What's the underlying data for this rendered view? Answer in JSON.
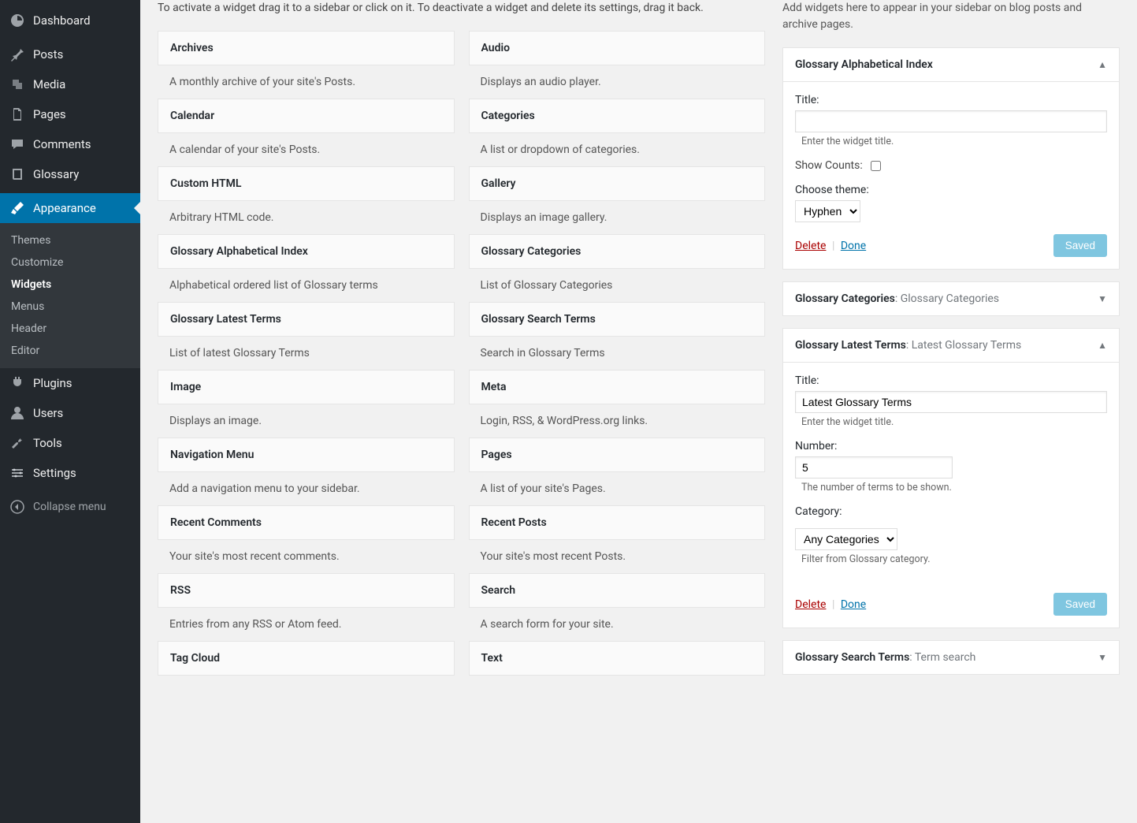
{
  "sidebar": {
    "items": [
      {
        "label": "Dashboard"
      },
      {
        "label": "Posts"
      },
      {
        "label": "Media"
      },
      {
        "label": "Pages"
      },
      {
        "label": "Comments"
      },
      {
        "label": "Glossary"
      },
      {
        "label": "Appearance"
      },
      {
        "label": "Plugins"
      },
      {
        "label": "Users"
      },
      {
        "label": "Tools"
      },
      {
        "label": "Settings"
      }
    ],
    "sub": [
      {
        "label": "Themes"
      },
      {
        "label": "Customize"
      },
      {
        "label": "Widgets"
      },
      {
        "label": "Menus"
      },
      {
        "label": "Header"
      },
      {
        "label": "Editor"
      }
    ],
    "collapse": "Collapse menu"
  },
  "intro": "To activate a widget drag it to a sidebar or click on it. To deactivate a widget and delete its settings, drag it back.",
  "widgets": [
    {
      "name": "Archives",
      "desc": "A monthly archive of your site's Posts."
    },
    {
      "name": "Audio",
      "desc": "Displays an audio player."
    },
    {
      "name": "Calendar",
      "desc": "A calendar of your site's Posts."
    },
    {
      "name": "Categories",
      "desc": "A list or dropdown of categories."
    },
    {
      "name": "Custom HTML",
      "desc": "Arbitrary HTML code."
    },
    {
      "name": "Gallery",
      "desc": "Displays an image gallery."
    },
    {
      "name": "Glossary Alphabetical Index",
      "desc": "Alphabetical ordered list of Glossary terms"
    },
    {
      "name": "Glossary Categories",
      "desc": "List of Glossary Categories"
    },
    {
      "name": "Glossary Latest Terms",
      "desc": "List of latest Glossary Terms"
    },
    {
      "name": "Glossary Search Terms",
      "desc": "Search in Glossary Terms"
    },
    {
      "name": "Image",
      "desc": "Displays an image."
    },
    {
      "name": "Meta",
      "desc": "Login, RSS, & WordPress.org links."
    },
    {
      "name": "Navigation Menu",
      "desc": "Add a navigation menu to your sidebar."
    },
    {
      "name": "Pages",
      "desc": "A list of your site's Pages."
    },
    {
      "name": "Recent Comments",
      "desc": "Your site's most recent comments."
    },
    {
      "name": "Recent Posts",
      "desc": "Your site's most recent Posts."
    },
    {
      "name": "RSS",
      "desc": "Entries from any RSS or Atom feed."
    },
    {
      "name": "Search",
      "desc": "A search form for your site."
    },
    {
      "name": "Tag Cloud",
      "desc": ""
    },
    {
      "name": "Text",
      "desc": ""
    }
  ],
  "rightIntro": "Add widgets here to appear in your sidebar on blog posts and archive pages.",
  "panel1": {
    "title": "Glossary Alphabetical Index",
    "titleLabel": "Title:",
    "titleHint": "Enter the widget title.",
    "titleValue": "",
    "showCountsLabel": "Show Counts:",
    "themeLabel": "Choose theme:",
    "themeValue": "Hyphen",
    "delete": "Delete",
    "done": "Done",
    "saved": "Saved"
  },
  "panel2": {
    "title": "Glossary Categories",
    "sub": ": Glossary Categories"
  },
  "panel3": {
    "title": "Glossary Latest Terms",
    "sub": ": Latest Glossary Terms",
    "titleLabel": "Title:",
    "titleValue": "Latest Glossary Terms",
    "titleHint": "Enter the widget title.",
    "numberLabel": "Number:",
    "numberValue": "5",
    "numberHint": "The number of terms to be shown.",
    "categoryLabel": "Category:",
    "categoryValue": "Any Categories",
    "categoryHint": "Filter from Glossary category.",
    "delete": "Delete",
    "done": "Done",
    "saved": "Saved"
  },
  "panel4": {
    "title": "Glossary Search Terms",
    "sub": ": Term search"
  }
}
